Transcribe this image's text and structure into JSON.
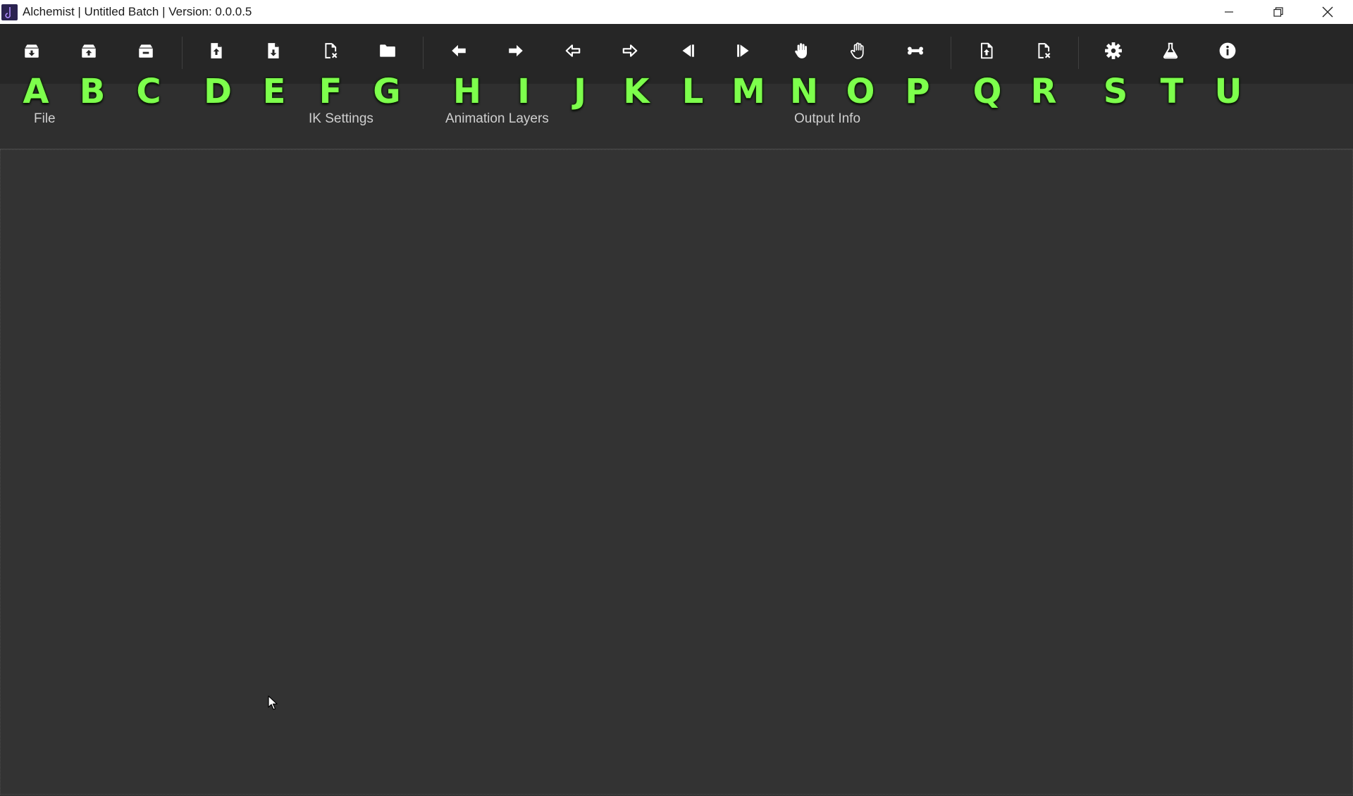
{
  "window": {
    "title": "Alchemist | Untitled Batch | Version: 0.0.0.5"
  },
  "toolbar": {
    "buttons": [
      {
        "icon": "archive-download-icon",
        "hint": "A"
      },
      {
        "icon": "archive-upload-icon",
        "hint": "B"
      },
      {
        "icon": "archive-remove-icon",
        "hint": "C"
      },
      {
        "icon": "file-upload-icon",
        "hint": "D"
      },
      {
        "icon": "file-download-icon",
        "hint": "E"
      },
      {
        "icon": "file-remove-icon",
        "hint": "F"
      },
      {
        "icon": "folder-icon",
        "hint": "G"
      },
      {
        "icon": "arrow-left-icon",
        "hint": "H"
      },
      {
        "icon": "arrow-right-icon",
        "hint": "I"
      },
      {
        "icon": "arrow-left-outline-icon",
        "hint": "J"
      },
      {
        "icon": "arrow-right-outline-icon",
        "hint": "K"
      },
      {
        "icon": "step-backward-icon",
        "hint": "L"
      },
      {
        "icon": "step-forward-icon",
        "hint": "M"
      },
      {
        "icon": "hand-filled-icon",
        "hint": "N"
      },
      {
        "icon": "hand-outline-icon",
        "hint": "O"
      },
      {
        "icon": "bone-icon",
        "hint": "P"
      },
      {
        "icon": "file-export-icon",
        "hint": "Q"
      },
      {
        "icon": "file-delete-icon",
        "hint": "R"
      },
      {
        "icon": "gear-icon",
        "hint": "S"
      },
      {
        "icon": "flask-icon",
        "hint": "T"
      },
      {
        "icon": "info-icon",
        "hint": "U"
      }
    ]
  },
  "groups": {
    "file": "File",
    "ik_settings": "IK Settings",
    "animation_layers": "Animation Layers",
    "output_info": "Output Info"
  },
  "colors": {
    "hint_letters": "#7dff4c",
    "toolbar_bg": "#262626",
    "content_bg": "#333333",
    "icon": "#ffffff"
  }
}
